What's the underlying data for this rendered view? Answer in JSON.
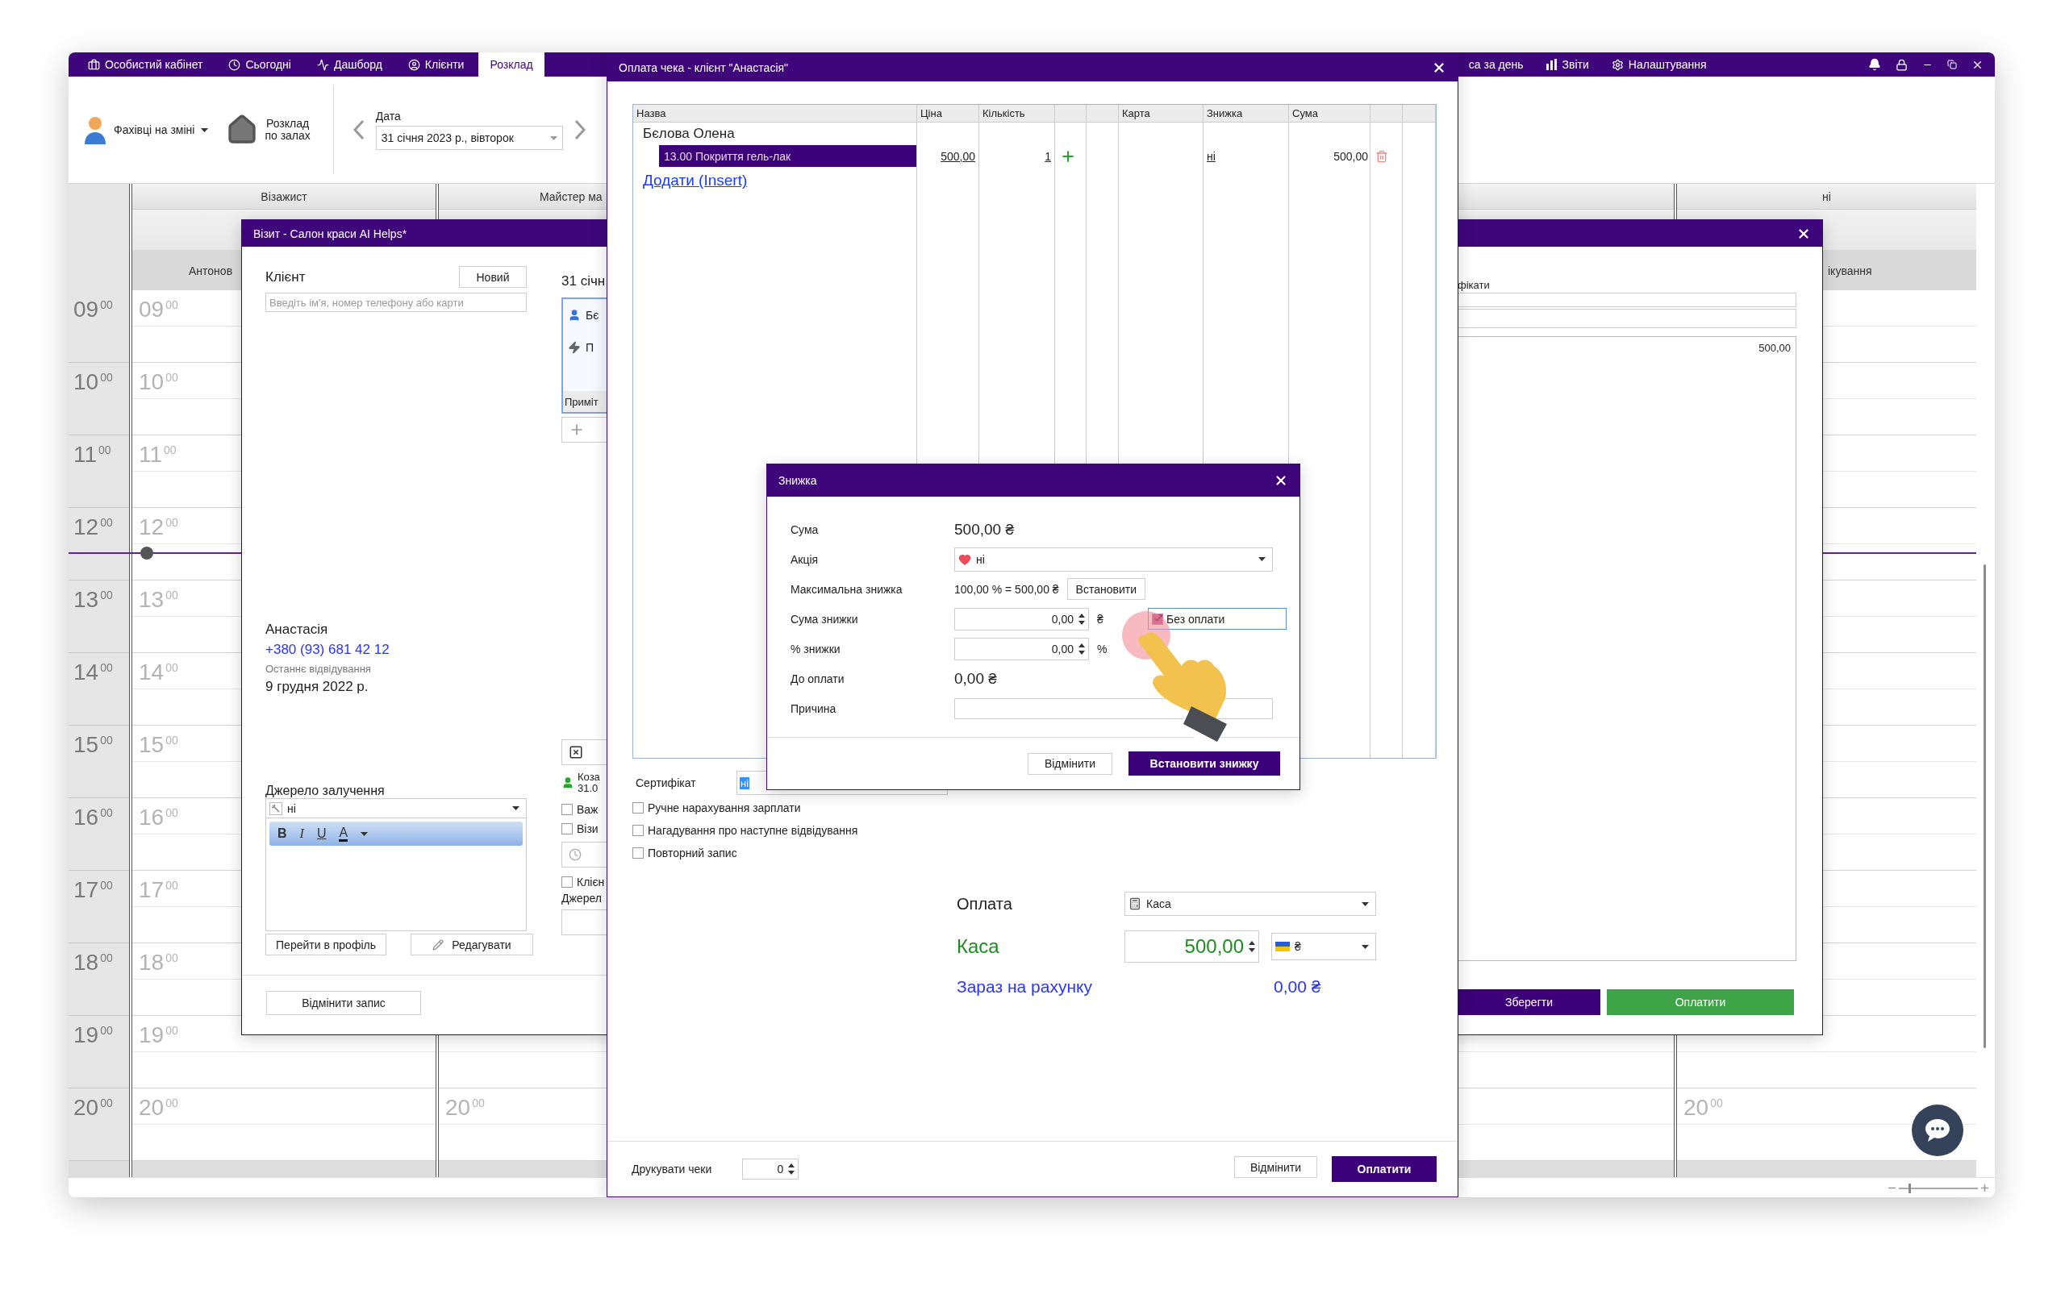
{
  "menu": {
    "items": [
      {
        "label": "Особистий кабінет",
        "selected": false
      },
      {
        "label": "Сьогодні",
        "selected": false
      },
      {
        "label": "Дашборд",
        "selected": false
      },
      {
        "label": "Клієнти",
        "selected": false
      },
      {
        "label": "Розклад",
        "selected": true
      }
    ],
    "right_items": [
      {
        "label": "са за день"
      },
      {
        "label": "Звіти"
      },
      {
        "label": "Налаштування"
      }
    ]
  },
  "toolbar": {
    "specialists": "Фахівці на зміні",
    "halls": [
      "Розклад",
      "по залах"
    ],
    "date_label": "Дата",
    "date": "31 січня 2023 р., вівторок"
  },
  "schedule": {
    "hours": [
      "09$^{00}$",
      "10$^{00}$",
      "11$^{00}$",
      "12$^{00}$",
      "13$^{00}$",
      "14$^{00}$",
      "15$^{00}$",
      "16$^{00}$",
      "17$^{00}$",
      "18$^{00}$",
      "19$^{00}$",
      "20$^{00}$"
    ],
    "columns": [
      {
        "title": "Візажист",
        "subtitle": "Антонов",
        "hour_marks": [
          "09$^{00}$",
          "10$^{00}$",
          "11$^{00}$",
          "12$^{00}$",
          "13$^{00}$",
          "14$^{00}$",
          "15$^{00}$",
          "16$^{00}$",
          "17$^{00}$",
          "18$^{00}$",
          "19$^{00}$",
          "20$^{00}$"
        ]
      },
      {
        "title": "Майстер ма",
        "hour_marks": [
          "20$^{00}$"
        ]
      },
      {
        "title": "ні",
        "subtitle": "ікування",
        "hour_marks": [
          "20$^{00}$"
        ]
      }
    ]
  },
  "visit": {
    "title": "Візит - Салон краси AI Helps*",
    "client_label": "Клієнт",
    "new_button": "Новий",
    "search_placeholder": "Введіть ім'я, номер телефону або карти",
    "client_name": "Анастасія",
    "phone": "+380 (93) 681 42 12",
    "last_visit_label": "Останнє відвідування",
    "last_visit": "9 грудня 2022 р.",
    "source_label": "Джерело залучення",
    "source_value": "ні",
    "editor_tools": [
      "B",
      "I",
      "U",
      "A"
    ],
    "profile_button": "Перейти в профіль",
    "edit_button": "Редагувати",
    "cancel_button": "Відмінити запис",
    "side": {
      "date": "31 січн",
      "card_lines": [
        "Бє",
        "П"
      ],
      "note": "Приміт",
      "staff": [
        "Коза",
        "31.0"
      ],
      "checks": [
        {
          "label": "Важ",
          "checked": false
        },
        {
          "label": "Візи",
          "checked": false
        }
      ],
      "client_check": {
        "label": "Клієн",
        "checked": false
      },
      "source": "Джерел"
    },
    "right": {
      "label": "фікати",
      "list_value": "500,00",
      "save_button": "Зберегти",
      "pay_button": "Оплатити"
    }
  },
  "payment": {
    "title": "Оплата чека - клієнт \"Анастасія\"",
    "columns": [
      {
        "label": "Назва"
      },
      {
        "label": "Ціна"
      },
      {
        "label": "Кількість"
      },
      {
        "kind": "blank"
      },
      {
        "kind": "blank"
      },
      {
        "label": "Карта"
      },
      {
        "label": "Знижка"
      },
      {
        "label": "Сума"
      },
      {
        "kind": "blank"
      },
      {
        "kind": "blank"
      }
    ],
    "group": "Бєлова Олена",
    "rows": [
      {
        "name": "13.00 Покриття гель-лак",
        "price": "500,00",
        "qty": "1",
        "discount": "ні",
        "sum": "500,00",
        "selected": true
      }
    ],
    "add_link": "Додати (Insert)",
    "certificate_label": "Сертифікат",
    "certificate_value": "ні",
    "options": [
      {
        "label": "Ручне нарахування зарплати",
        "checked": false
      },
      {
        "label": "Нагадування про наступне відвідування",
        "checked": false
      },
      {
        "label": "Повторний запис",
        "checked": false
      }
    ],
    "payment_label": "Оплата",
    "payment_method": "Каса",
    "cash_label": "Каса",
    "cash_amount": "500,00",
    "currency": "₴",
    "balance_label": "Зараз на рахунку",
    "balance": "0,00 ₴",
    "print_label": "Друкувати чеки",
    "print_count": "0",
    "cancel_button": "Відмінити",
    "pay_button": "Оплатити"
  },
  "zoom": {
    "level": 0.12
  },
  "discount": {
    "title": "Знижка",
    "rows": [
      {
        "kind": "amount",
        "label": "Сума",
        "value": "500,00 ₴"
      },
      {
        "kind": "select",
        "label": "Акція",
        "value": "ні"
      },
      {
        "kind": "max",
        "label": "Максимальна знижка",
        "value": "100,00 % = 500,00 ₴",
        "button": "Встановити"
      },
      {
        "kind": "spin",
        "label": "Сума знижки",
        "value": "0,00",
        "unit": "₴",
        "check": {
          "label": "Без оплати",
          "checked": true
        }
      },
      {
        "kind": "spin",
        "label": "% знижки",
        "value": "0,00",
        "unit": "%"
      },
      {
        "kind": "amount",
        "label": "До оплати",
        "value": "0,00 ₴"
      },
      {
        "kind": "text",
        "label": "Причина"
      }
    ],
    "cancel_button": "Відмінити",
    "apply_button": "Встановити знижку"
  }
}
